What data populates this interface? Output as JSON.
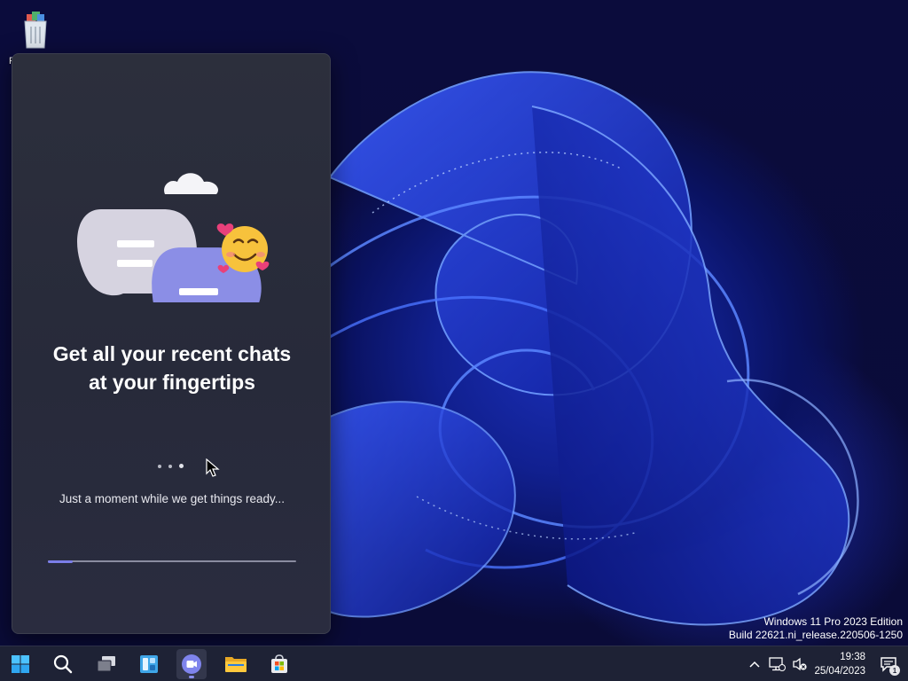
{
  "desktop": {
    "recycle_bin_label": "R"
  },
  "chat_flyout": {
    "headline": "Get all your recent chats at your fingertips",
    "loading_text": "Just a moment while we get things ready...",
    "progress_fraction": 0.1
  },
  "watermark": {
    "edition": "Windows 11 Pro 2023 Edition",
    "build": "Build 22621.ni_release.220506-1250"
  },
  "taskbar": {
    "apps": [
      {
        "name": "start",
        "icon": "windows-logo-icon",
        "active": false
      },
      {
        "name": "search",
        "icon": "search-icon",
        "active": false
      },
      {
        "name": "task-view",
        "icon": "task-view-icon",
        "active": false
      },
      {
        "name": "widgets",
        "icon": "widgets-icon",
        "active": false
      },
      {
        "name": "chat",
        "icon": "teams-chat-icon",
        "active": true
      },
      {
        "name": "file-explorer",
        "icon": "folder-icon",
        "active": false
      },
      {
        "name": "microsoft-store",
        "icon": "store-icon",
        "active": false
      }
    ],
    "clock": {
      "time": "19:38",
      "date": "25/04/2023"
    },
    "notification_count": "1"
  },
  "colors": {
    "accent": "#7b7ee8",
    "flyout_bg": "#2b2e3d",
    "taskbar_bg": "#1e2235"
  }
}
